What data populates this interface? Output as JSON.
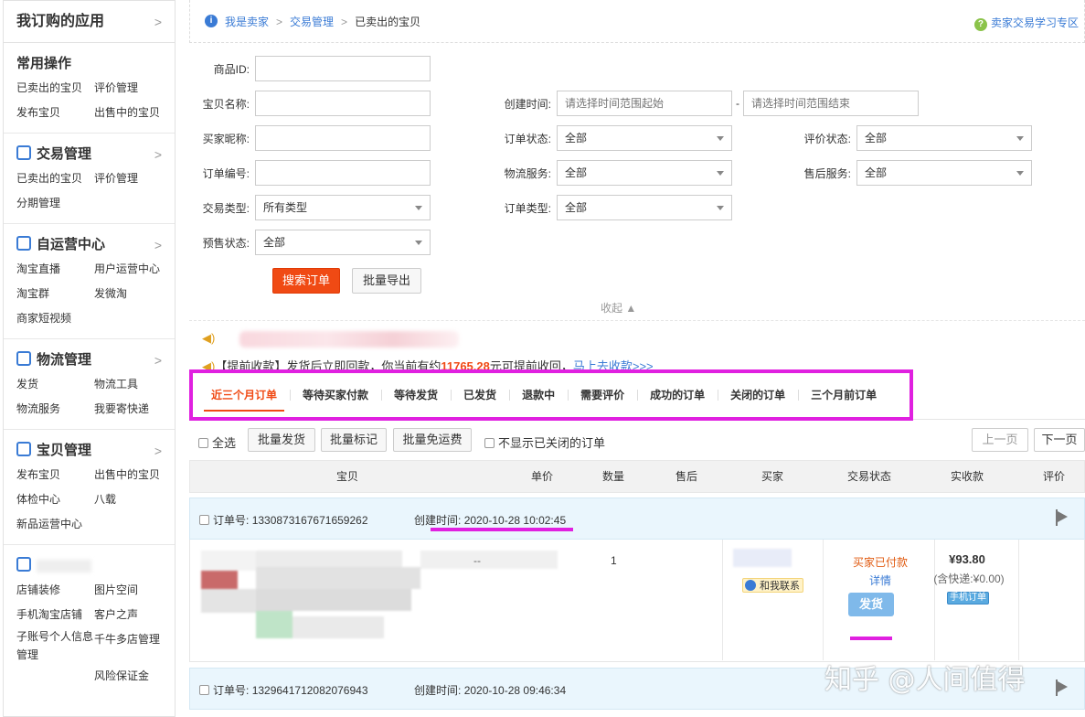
{
  "sidebar": {
    "top_title": "我订购的应用",
    "top_chevron": ">",
    "common": {
      "title": "常用操作",
      "items": [
        "已卖出的宝贝",
        "评价管理",
        "发布宝贝",
        "出售中的宝贝"
      ]
    },
    "trade": {
      "title": "交易管理",
      "chevron": ">",
      "items": [
        "已卖出的宝贝",
        "评价管理",
        "分期管理"
      ]
    },
    "self_ops": {
      "title": "自运营中心",
      "chevron": ">",
      "items": [
        "淘宝直播",
        "用户运营中心",
        "淘宝群",
        "发微淘",
        "商家短视频"
      ]
    },
    "logistics": {
      "title": "物流管理",
      "chevron": ">",
      "items": [
        "发货",
        "物流工具",
        "物流服务",
        "我要寄快递"
      ]
    },
    "goods": {
      "title": "宝贝管理",
      "chevron": ">",
      "items": [
        "发布宝贝",
        "出售中的宝贝",
        "体检中心",
        "八载",
        "新品运营中心"
      ]
    },
    "store": {
      "items": [
        "店铺装修",
        "图片空间",
        "手机淘宝店铺",
        "客户之声",
        "子账号个人信息管理",
        "千牛多店管理",
        "风险保证金"
      ]
    }
  },
  "breadcrumb": {
    "items": [
      "我是卖家",
      "交易管理",
      "已卖出的宝贝"
    ],
    "sep": ">",
    "help": "卖家交易学习专区"
  },
  "form": {
    "item_id_label": "商品ID:",
    "item_name_label": "宝贝名称:",
    "buyer_label": "买家昵称:",
    "order_no_label": "订单编号:",
    "trade_type_label": "交易类型:",
    "trade_type_value": "所有类型",
    "presale_label": "预售状态:",
    "presale_value": "全部",
    "created_label": "创建时间:",
    "created_start_placeholder": "请选择时间范围起始",
    "created_end_placeholder": "请选择时间范围结束",
    "range_dash": "-",
    "order_status_label": "订单状态:",
    "order_status_value": "全部",
    "logistics_label": "物流服务:",
    "logistics_value": "全部",
    "order_type_label": "订单类型:",
    "order_type_value": "全部",
    "review_status_label": "评价状态:",
    "review_status_value": "全部",
    "aftersale_label": "售后服务:",
    "aftersale_value": "全部",
    "search_button": "搜索订单",
    "export_button": "批量导出",
    "collapse": "收起 ▲"
  },
  "notice": {
    "prefix": "【提前收款】发货后立即回款，你当前有约",
    "amount": "11765.28",
    "suffix": "元可提前收回，",
    "link": "马上去收款>>>"
  },
  "tabs": [
    "近三个月订单",
    "等待买家付款",
    "等待发货",
    "已发货",
    "退款中",
    "需要评价",
    "成功的订单",
    "关闭的订单",
    "三个月前订单"
  ],
  "toolbar": {
    "select_all": "全选",
    "batch_ship": "批量发货",
    "batch_mark": "批量标记",
    "batch_free_ship": "批量免运费",
    "hide_closed": "不显示已关闭的订单",
    "prev_page": "上一页",
    "next_page": "下一页"
  },
  "table_headers": [
    "宝贝",
    "单价",
    "数量",
    "售后",
    "买家",
    "交易状态",
    "实收款",
    "评价"
  ],
  "orders": [
    {
      "order_no_label": "订单号:",
      "order_no": "1330873167671659262",
      "created_label": "创建时间:",
      "created": "2020-10-28 10:02:45",
      "unit_price": "--",
      "quantity": "1",
      "contact": "和我联系",
      "status": "买家已付款",
      "detail": "详情",
      "ship_button": "发货",
      "amount": "¥93.80",
      "shipping_fee": "(含快递:¥0.00)",
      "mobile_tag": "手机订单"
    },
    {
      "order_no_label": "订单号:",
      "order_no": "1329641712082076943",
      "created_label": "创建时间:",
      "created": "2020-10-28 09:46:34"
    }
  ],
  "watermark": "知乎 @人间值得",
  "colors": {
    "accent": "#f04a14",
    "link": "#3a7bd5",
    "highlight": "#e020e0",
    "order_header_bg": "#eaf6fd"
  }
}
